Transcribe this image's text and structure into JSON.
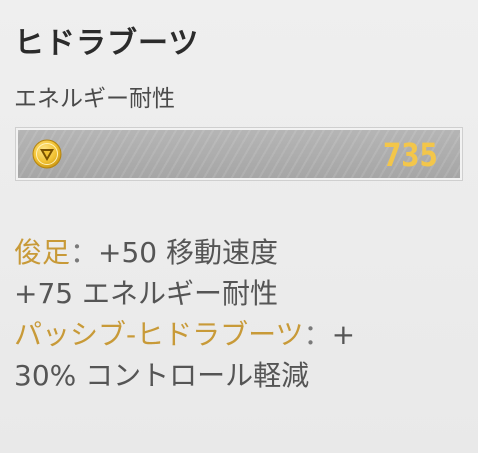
{
  "item": {
    "name": "ヒドラブーツ",
    "type": "エネルギー耐性",
    "price": "735",
    "price_icon": "gold-coin-icon"
  },
  "stats": {
    "line1_label": "俊足",
    "line1_sep": "：",
    "line1_value": "+50 移動速度",
    "line2": "+75 エネルギー耐性",
    "line3_label": "パッシブ-ヒドラブーツ",
    "line3_sep": "：",
    "line3_value": "+",
    "line4": "30% コントロール軽減"
  },
  "colors": {
    "accent_gold": "#c89a38",
    "price_gold": "#f3c64a",
    "body_text": "#555555"
  }
}
